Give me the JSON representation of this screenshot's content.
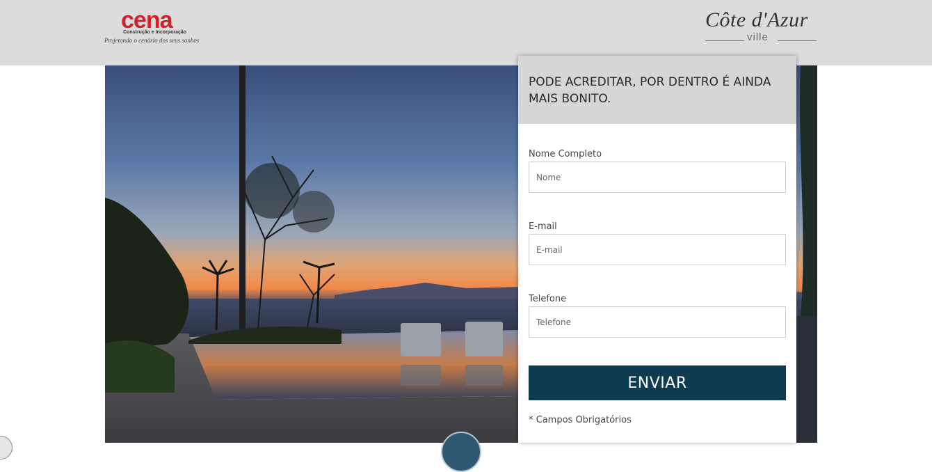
{
  "header": {
    "left_logo": {
      "brand": "cena",
      "subtitle": "Construção e Incorporação",
      "tagline": "Projetando o cenário dos seus sonhos"
    },
    "right_logo": {
      "name": "Côte d'Azur",
      "sub": "ville"
    }
  },
  "form": {
    "heading": "PODE ACREDITAR, POR DENTRO É AINDA MAIS BONITO.",
    "fields": [
      {
        "label": "Nome Completo",
        "placeholder": "Nome",
        "value": ""
      },
      {
        "label": "E-mail",
        "placeholder": "E-mail",
        "value": ""
      },
      {
        "label": "Telefone",
        "placeholder": "Telefone",
        "value": ""
      }
    ],
    "submit_label": "ENVIAR",
    "required_note": "* Campos Obrigatórios"
  },
  "colors": {
    "header_bg": "#dcdcdc",
    "form_head_bg": "#d6d6d6",
    "button_bg": "#0e3b52",
    "brand_red": "#d0202a"
  }
}
